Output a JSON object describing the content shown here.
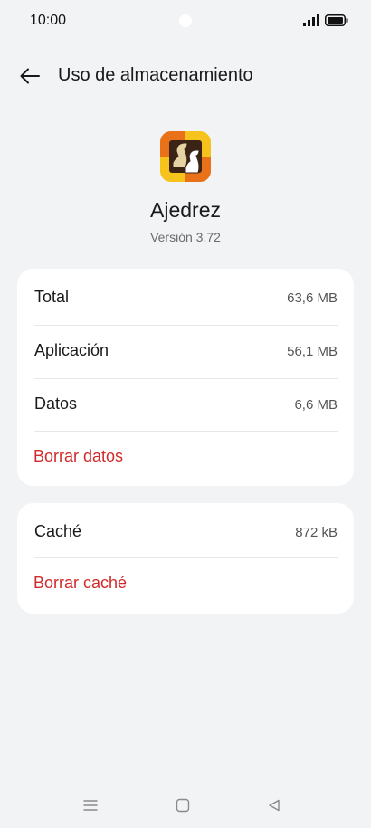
{
  "status_bar": {
    "time": "10:00",
    "icons": [
      "signal-icon",
      "battery-icon"
    ]
  },
  "header": {
    "title": "Uso de almacenamiento",
    "back_icon": "arrow-left-icon"
  },
  "app": {
    "name": "Ajedrez",
    "version": "Versión 3.72",
    "icon": "chess-app-icon"
  },
  "storage": {
    "rows": [
      {
        "label": "Total",
        "value": "63,6 MB"
      },
      {
        "label": "Aplicación",
        "value": "56,1 MB"
      },
      {
        "label": "Datos",
        "value": "6,6 MB"
      }
    ],
    "clear_data_label": "Borrar datos"
  },
  "cache": {
    "label": "Caché",
    "value": "872 kB",
    "clear_cache_label": "Borrar caché"
  },
  "nav_bar": {
    "buttons": [
      "menu-icon",
      "home-icon",
      "back-triangle-icon"
    ]
  },
  "colors": {
    "background": "#f2f3f5",
    "card": "#ffffff",
    "accent_red": "#d22a2a",
    "icon_orange": "#e8711a",
    "icon_yellow": "#f6c21c"
  }
}
